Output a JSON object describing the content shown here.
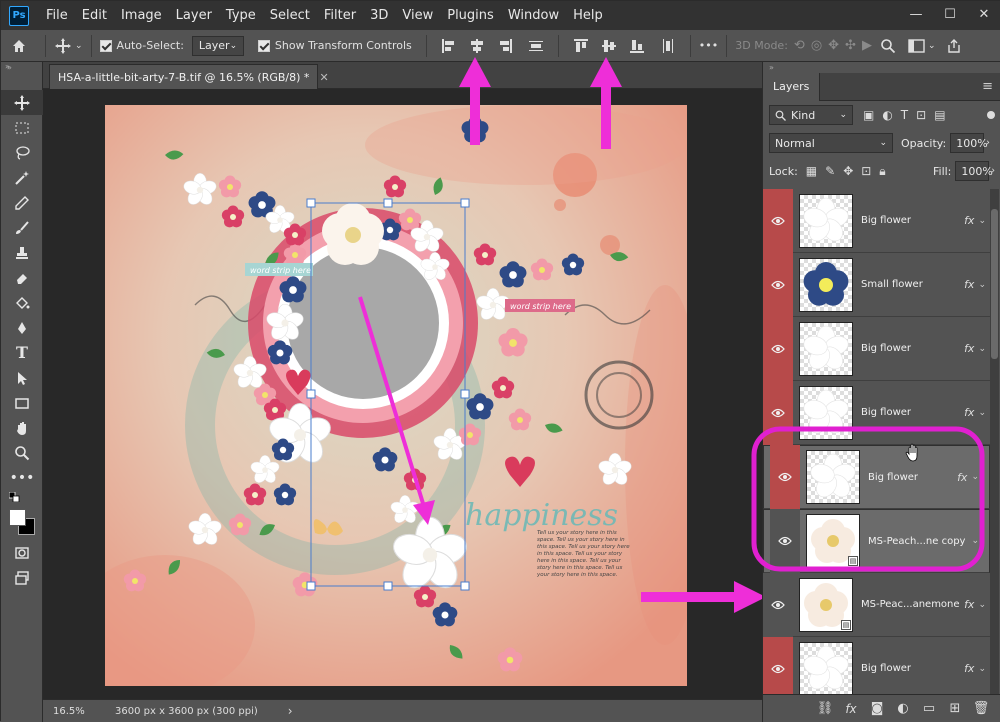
{
  "app": {
    "logo": "Ps"
  },
  "menu": [
    "File",
    "Edit",
    "Image",
    "Layer",
    "Type",
    "Select",
    "Filter",
    "3D",
    "View",
    "Plugins",
    "Window",
    "Help"
  ],
  "window_controls": [
    "—",
    "☐",
    "✕"
  ],
  "options": {
    "auto_select_label": "Auto-Select:",
    "auto_select_value": "Layer",
    "show_transform_label": "Show Transform Controls",
    "mode_3d_label": "3D Mode:",
    "more": "•••"
  },
  "document": {
    "tab_title": "HSA-a-little-bit-arty-7-B.tif @ 16.5% (RGB/8) *",
    "tab_close": "✕"
  },
  "artwork_text": {
    "word_strip_1": "word strip here",
    "word_strip_2": "word strip here",
    "happiness": "happiness",
    "journal": "Tell us your story here in this space. Tell us your story here in this space. Tell us your story here in this space. Tell us your story here in this space. Tell us your story here in this space. Tell us your story here in this space."
  },
  "status": {
    "zoom": "16.5%",
    "doc_info": "3600 px x 3600 px (300 ppi)",
    "arrow": "›"
  },
  "panel": {
    "tab_label": "Layers",
    "filter_kind": "Kind",
    "blend_mode": "Normal",
    "opacity_label": "Opacity:",
    "opacity_value": "100%",
    "lock_label": "Lock:",
    "fill_label": "Fill:",
    "fill_value": "100%"
  },
  "layers": [
    {
      "name": "Big flower",
      "type": "white-flower",
      "fx": "fx",
      "eye_color": "red"
    },
    {
      "name": "Small flower",
      "type": "blue-flower",
      "fx": "fx",
      "eye_color": "red"
    },
    {
      "name": "Big flower",
      "type": "white-flower",
      "fx": "fx",
      "eye_color": "red"
    },
    {
      "name": "Big flower",
      "type": "white-flower",
      "fx": "fx",
      "eye_color": "red"
    },
    {
      "name": "Big flower",
      "type": "white-flower",
      "fx": "fx",
      "eye_color": "red"
    },
    {
      "name": "MS-Peach...ne copy",
      "type": "anemone",
      "fx": "",
      "eye_color": "none"
    },
    {
      "name": "MS-Peac...anemone",
      "type": "anemone",
      "fx": "fx",
      "eye_color": "none"
    },
    {
      "name": "Big flower",
      "type": "white-flower",
      "fx": "fx",
      "eye_color": "red"
    }
  ],
  "colors": {
    "accent_arrow": "#ee2ed8",
    "highlight_ring": "#e020d0",
    "eye_red": "#b74a4a"
  }
}
